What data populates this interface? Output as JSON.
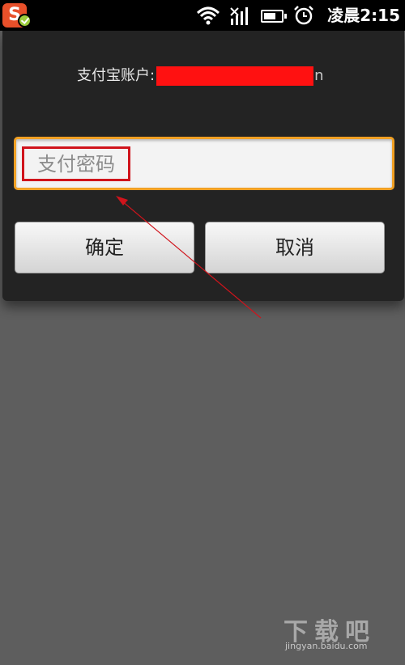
{
  "status_bar": {
    "app_icon_letter": "S",
    "icons": [
      "wifi-icon",
      "signal-icon",
      "battery-icon",
      "alarm-icon"
    ],
    "time": "凌晨2:15",
    "battery_level": 0.6
  },
  "dialog": {
    "account_label": "支付宝账户",
    "account_colon": ":",
    "account_suffix": "n",
    "password_placeholder": "支付密码",
    "password_value": "",
    "ok_label": "确定",
    "cancel_label": "取消"
  },
  "watermark": {
    "line1": "下载吧",
    "line2": "jingyan.baidu.com"
  },
  "colors": {
    "overlay_bg": "#5e5e5e",
    "dialog_bg": "#232323",
    "field_focus_border": "#f0a024",
    "annotation_red": "#d0141c",
    "redaction_red": "#ff1111"
  }
}
